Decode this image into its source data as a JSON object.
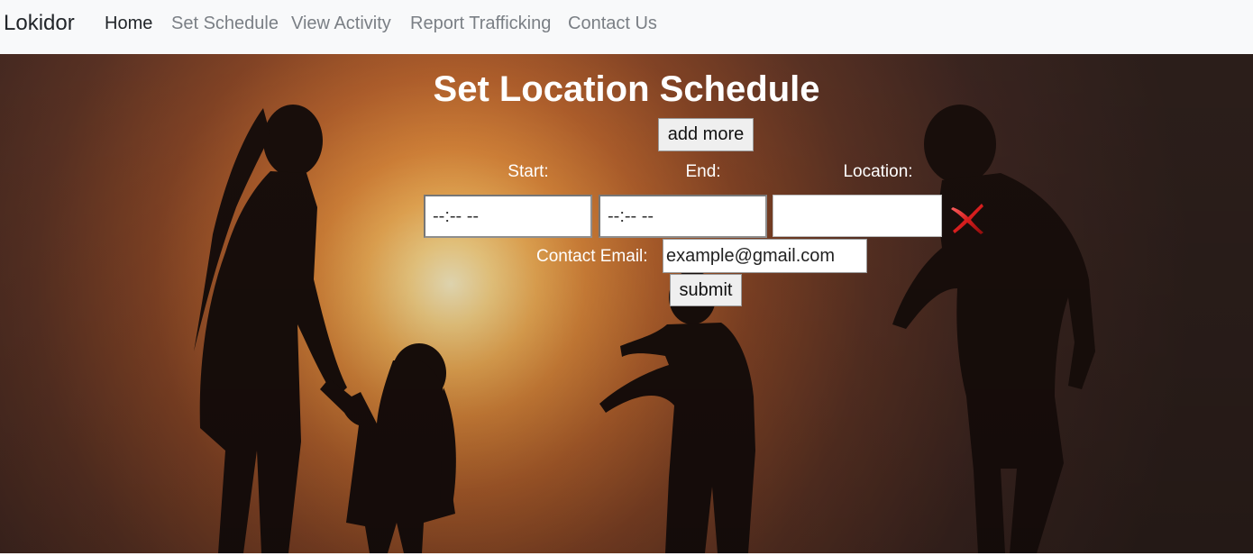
{
  "navbar": {
    "brand": "Lokidor",
    "items": [
      {
        "label": "Home",
        "active": true
      },
      {
        "label": "Set Schedule",
        "active": false
      },
      {
        "label": "View Activity",
        "active": false
      },
      {
        "label": "Report Trafficking",
        "active": false
      },
      {
        "label": "Contact Us",
        "active": false
      }
    ]
  },
  "hero": {
    "title": "Set Location Schedule",
    "add_more_label": "add more",
    "columns": {
      "start": "Start:",
      "end": "End:",
      "location": "Location:"
    },
    "schedule_row": {
      "start_value": "--:-- --",
      "end_value": "--:-- --",
      "location_value": "",
      "remove_icon": "red-x-icon"
    },
    "contact_email_label": "Contact Email:",
    "contact_email_value": "example@gmail.com",
    "submit_label": "submit"
  },
  "colors": {
    "navbar_bg": "#f8f9fa",
    "nav_active": "#212529",
    "nav_inactive": "#7a7f85",
    "hero_text": "#ffffff",
    "remove_icon": "#d81e1e"
  }
}
